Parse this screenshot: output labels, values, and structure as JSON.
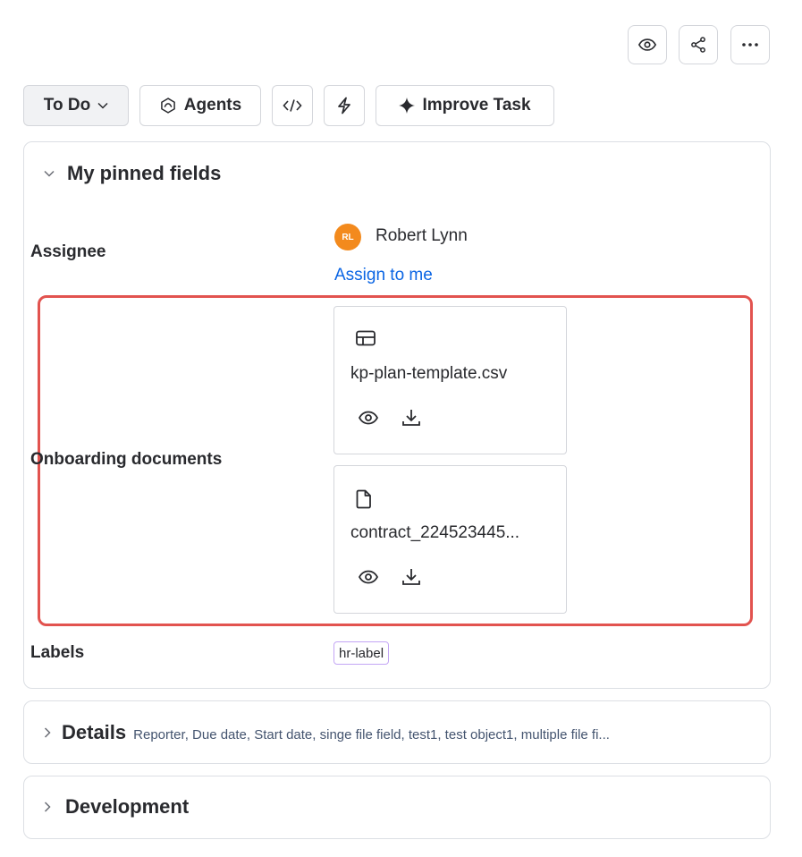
{
  "header_actions": {
    "watch_icon": "eye-icon",
    "share_icon": "share-icon",
    "more_icon": "more-horizontal-icon"
  },
  "toolbar": {
    "status_label": "To Do",
    "agents_label": "Agents",
    "improve_label": "Improve Task"
  },
  "pinned": {
    "title": "My pinned fields",
    "assignee": {
      "label": "Assignee",
      "initials": "RL",
      "name": "Robert Lynn",
      "assign_link": "Assign to me"
    },
    "onboarding": {
      "label": "Onboarding documents",
      "files": [
        {
          "name": "kp-plan-template.csv",
          "icon": "table-icon"
        },
        {
          "name": "contract_224523445...",
          "icon": "file-icon"
        }
      ]
    },
    "labels": {
      "label": "Labels",
      "value": "hr-label"
    }
  },
  "details": {
    "title": "Details",
    "summary": "Reporter, Due date, Start date, singe file field, test1, test object1, multiple file fi..."
  },
  "development": {
    "title": "Development"
  },
  "colors": {
    "highlight": "#e2534f",
    "link": "#0c66e4",
    "avatar": "#f38a1d",
    "label_border": "#c4a6f5"
  }
}
